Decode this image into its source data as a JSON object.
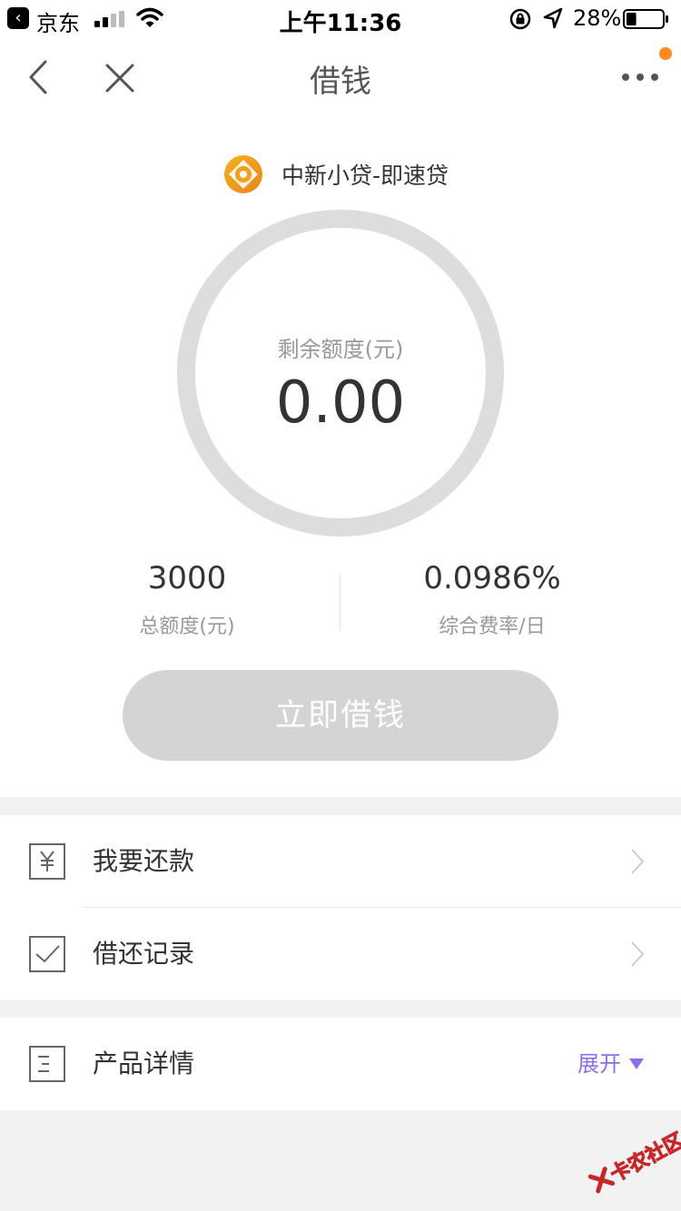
{
  "status_bar": {
    "carrier": "京东",
    "time": "上午11:36",
    "battery": "28%",
    "battery_level": 0.28
  },
  "nav": {
    "title": "借钱"
  },
  "product": {
    "name": "中新小贷-即速贷",
    "logo_colors": [
      "#f5b21e",
      "#e8861b"
    ]
  },
  "credit": {
    "remaining_label": "剩余额度(元)",
    "remaining_value": "0.00",
    "total_value": "3000",
    "total_label": "总额度(元)",
    "rate_value": "0.0986%",
    "rate_label": "综合费率/日"
  },
  "cta": {
    "label": "立即借钱"
  },
  "menu": {
    "repay": "我要还款",
    "records": "借还记录",
    "details": "产品详情",
    "expand": "展开"
  },
  "colors": {
    "accent": "#8c6fe8",
    "notify": "#ff8a1f",
    "ring": "#dddddd",
    "button_disabled": "#d4d4d4"
  },
  "watermark": {
    "text": "卡农社区"
  }
}
